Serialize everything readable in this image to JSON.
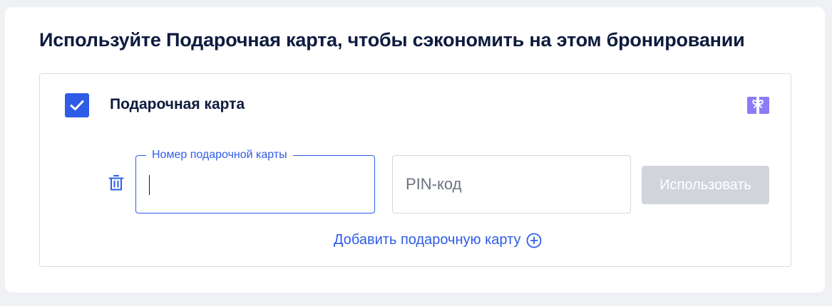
{
  "header": {
    "title": "Используйте Подарочная карта, чтобы сэкономить на этом бронировании"
  },
  "gift_card": {
    "checkbox_checked": true,
    "label": "Подарочная карта",
    "card_number": {
      "label": "Номер подарочной карты",
      "value": ""
    },
    "pin": {
      "placeholder": "PIN-код",
      "value": ""
    },
    "apply_button_label": "Использовать",
    "add_card_label": "Добавить подарочную карту"
  },
  "icons": {
    "checkbox": "check-icon",
    "gift": "gift-card-icon",
    "trash": "trash-icon",
    "add": "plus-circle-icon"
  },
  "colors": {
    "accent": "#2e5ce6",
    "gift_icon": "#8b7cf6",
    "heading": "#0d1b3e",
    "disabled_button": "#d1d5db",
    "background": "#eff1f5"
  }
}
